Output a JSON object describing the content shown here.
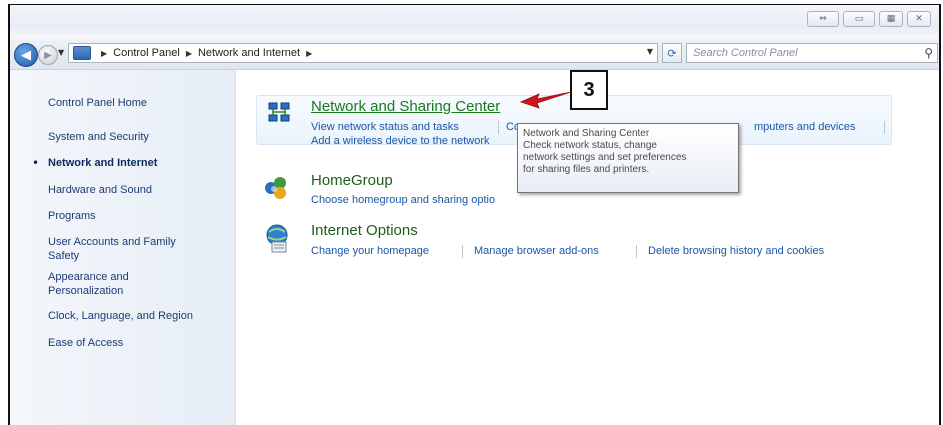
{
  "window": {
    "buttons": [
      "⇔",
      "▭",
      "▦",
      "✕"
    ]
  },
  "nav": {
    "back_glyph": "◀",
    "forward_glyph": "▶",
    "breadcrumbs": [
      "Control Panel",
      "Network and Internet"
    ],
    "search_placeholder": "Search Control Panel"
  },
  "sidebar": {
    "items": [
      {
        "label": "Control Panel Home"
      },
      {
        "label": "System and Security"
      },
      {
        "label": "Network and Internet",
        "current": true
      },
      {
        "label": "Hardware and Sound"
      },
      {
        "label": "Programs"
      },
      {
        "label": "User Accounts and Family"
      },
      {
        "label": "Safety"
      },
      {
        "label": "Appearance and"
      },
      {
        "label": "Personalization"
      },
      {
        "label": "Clock, Language, and Region"
      },
      {
        "label": "Ease of Access"
      }
    ]
  },
  "categories": [
    {
      "title": "Network and Sharing Center",
      "icon": "network-sharing-icon",
      "links": [
        "View network status and tasks",
        "Co",
        "mputers and devices",
        "Add a wireless device to the network"
      ]
    },
    {
      "title": "HomeGroup",
      "icon": "homegroup-icon",
      "links": [
        "Choose homegroup and sharing optio"
      ]
    },
    {
      "title": "Internet Options",
      "icon": "internet-options-icon",
      "links": [
        "Change your homepage",
        "Manage browser add-ons",
        "Delete browsing history and cookies"
      ]
    }
  ],
  "tooltip": {
    "lines": [
      "Network and Sharing Center",
      "Check network status, change",
      "network settings and set preferences",
      "for sharing files and printers."
    ]
  },
  "callout": {
    "number": "3"
  },
  "colors": {
    "link": "#1a56a8",
    "category_title": "#1a7a1a",
    "arrow": "#d0161c"
  }
}
